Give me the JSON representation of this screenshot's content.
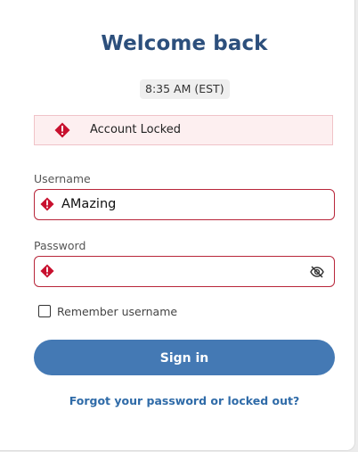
{
  "login": {
    "title": "Welcome back",
    "time": "8:35 AM (EST)",
    "alert": {
      "icon": "error-diamond-icon",
      "text": "Account Locked",
      "color": "#c8102e"
    },
    "username": {
      "label": "Username",
      "value": "AMazing"
    },
    "password": {
      "label": "Password",
      "value": "",
      "toggle_icon": "eye-slash-icon"
    },
    "remember": {
      "label": "Remember username",
      "checked": false
    },
    "signin_label": "Sign in",
    "forgot_link": "Forgot your password or locked out?"
  },
  "colors": {
    "title": "#2c4f7c",
    "primary": "#4479b4",
    "error": "#b8263a",
    "link": "#2f6ba8"
  }
}
